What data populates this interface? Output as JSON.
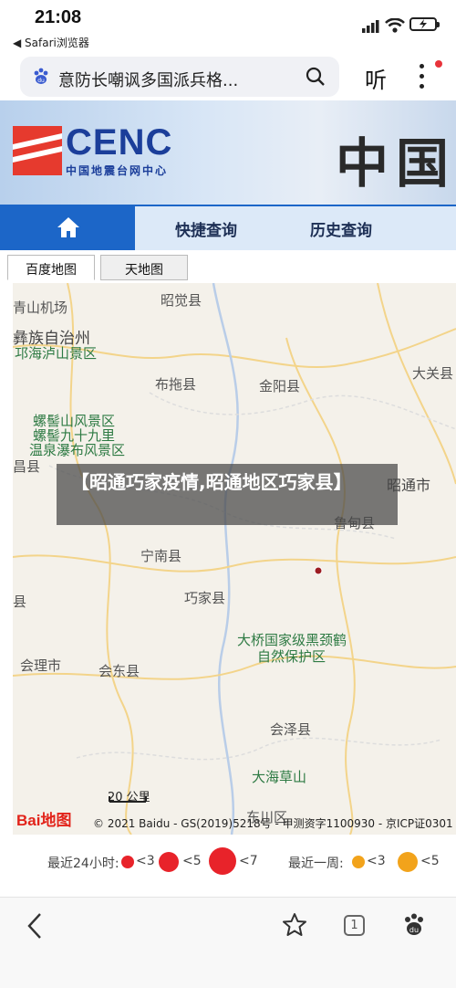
{
  "status": {
    "time": "21:08",
    "back_app": "◀ Safari浏览器"
  },
  "search": {
    "query": "意防长嘲讽多国派兵格...",
    "voice_label": "听"
  },
  "header": {
    "logo_text": "CENC",
    "logo_subtitle": "中国地震台网中心",
    "banner_text": "中国"
  },
  "nav": {
    "items": [
      {
        "label": "快捷查询"
      },
      {
        "label": "历史查询"
      }
    ]
  },
  "map_tabs": [
    {
      "label": "百度地图"
    },
    {
      "label": "天地图"
    }
  ],
  "map": {
    "places": [
      {
        "label": "青山机场"
      },
      {
        "label": "昭觉县"
      },
      {
        "label": "彝族自治州"
      },
      {
        "label": "邛海泸山景区"
      },
      {
        "label": "布拖县"
      },
      {
        "label": "金阳县"
      },
      {
        "label": "大关县"
      },
      {
        "label": "螺髻山风景区"
      },
      {
        "label": "螺髻九十九里"
      },
      {
        "label": "温泉瀑布风景区"
      },
      {
        "label": "昌县"
      },
      {
        "label": "昭通市"
      },
      {
        "label": "鲁甸县"
      },
      {
        "label": "宁南县"
      },
      {
        "label": "巧家县"
      },
      {
        "label": "县"
      },
      {
        "label": "大桥国家级黑颈鹤"
      },
      {
        "label": "自然保护区"
      },
      {
        "label": "会理市"
      },
      {
        "label": "会东县"
      },
      {
        "label": "会泽县"
      },
      {
        "label": "大海草山"
      },
      {
        "label": "东川区"
      }
    ],
    "scale_label": "20 公里",
    "copyright": "© 2021 Baidu - GS(2019)5218号 - 甲测资字1100930 - 京ICP证0301",
    "logo_text": "Bai地图",
    "overlay_title": "【昭通巧家疫情,昭通地区巧家县】"
  },
  "legend": {
    "recent24_label": "最近24小时:",
    "recent_week_label": "最近一周:",
    "lt3": "<3",
    "lt5": "<5",
    "lt7": "<7",
    "colors": {
      "day": "#e8232a",
      "week": "#f2a31b"
    }
  },
  "bottom_bar": {
    "tab_count": "1"
  }
}
